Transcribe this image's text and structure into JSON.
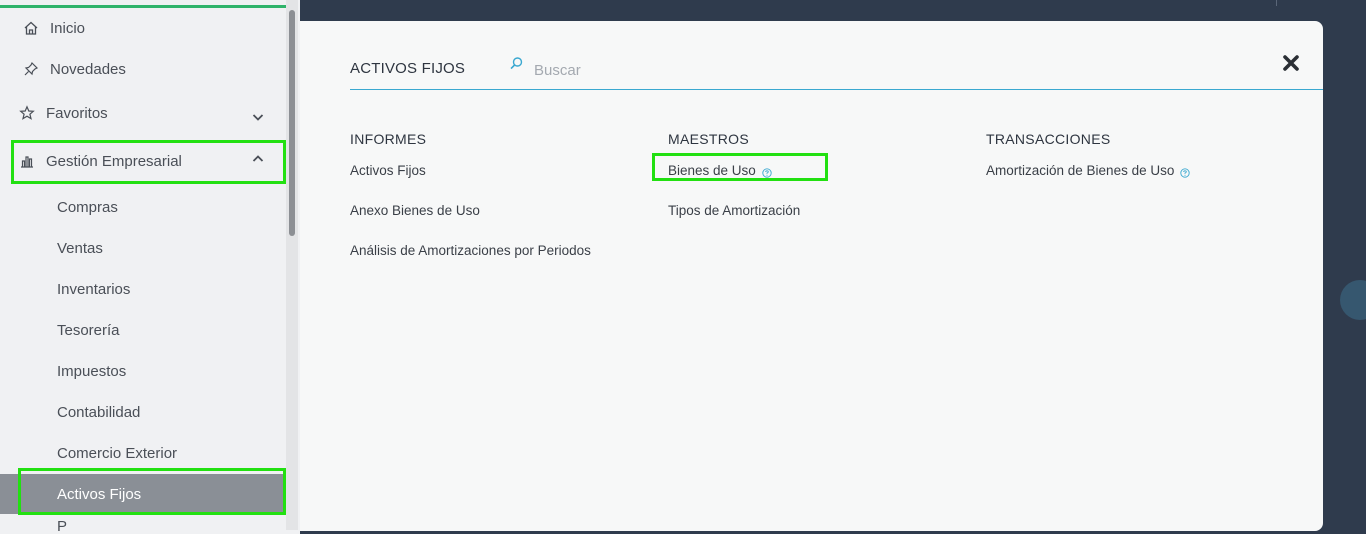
{
  "sidebar": {
    "items": [
      {
        "label": "Inicio",
        "icon": "home-icon"
      },
      {
        "label": "Novedades",
        "icon": "pin-icon"
      },
      {
        "label": "Favoritos",
        "icon": "star-icon"
      },
      {
        "label": "Gestión Empresarial",
        "icon": "bar-chart-icon"
      }
    ],
    "subitems": [
      "Compras",
      "Ventas",
      "Inventarios",
      "Tesorería",
      "Impuestos",
      "Contabilidad",
      "Comercio Exterior",
      "Activos Fijos",
      "P"
    ]
  },
  "modal": {
    "title": "ACTIVOS FIJOS",
    "search_placeholder": "Buscar",
    "columns": [
      {
        "header": "INFORMES",
        "links": [
          "Activos Fijos",
          "Anexo Bienes de Uso",
          "Análisis de Amortizaciones por Periodos"
        ]
      },
      {
        "header": "MAESTROS",
        "links": [
          "Bienes de Uso",
          "Tipos de Amortización"
        ]
      },
      {
        "header": "TRANSACCIONES",
        "links": [
          "Amortización de Bienes de Uso"
        ]
      }
    ]
  },
  "colors": {
    "accent": "#3aa8d0",
    "highlight": "#22e011",
    "active_item": "#8a8f96",
    "backdrop": "#2f3b4d"
  }
}
